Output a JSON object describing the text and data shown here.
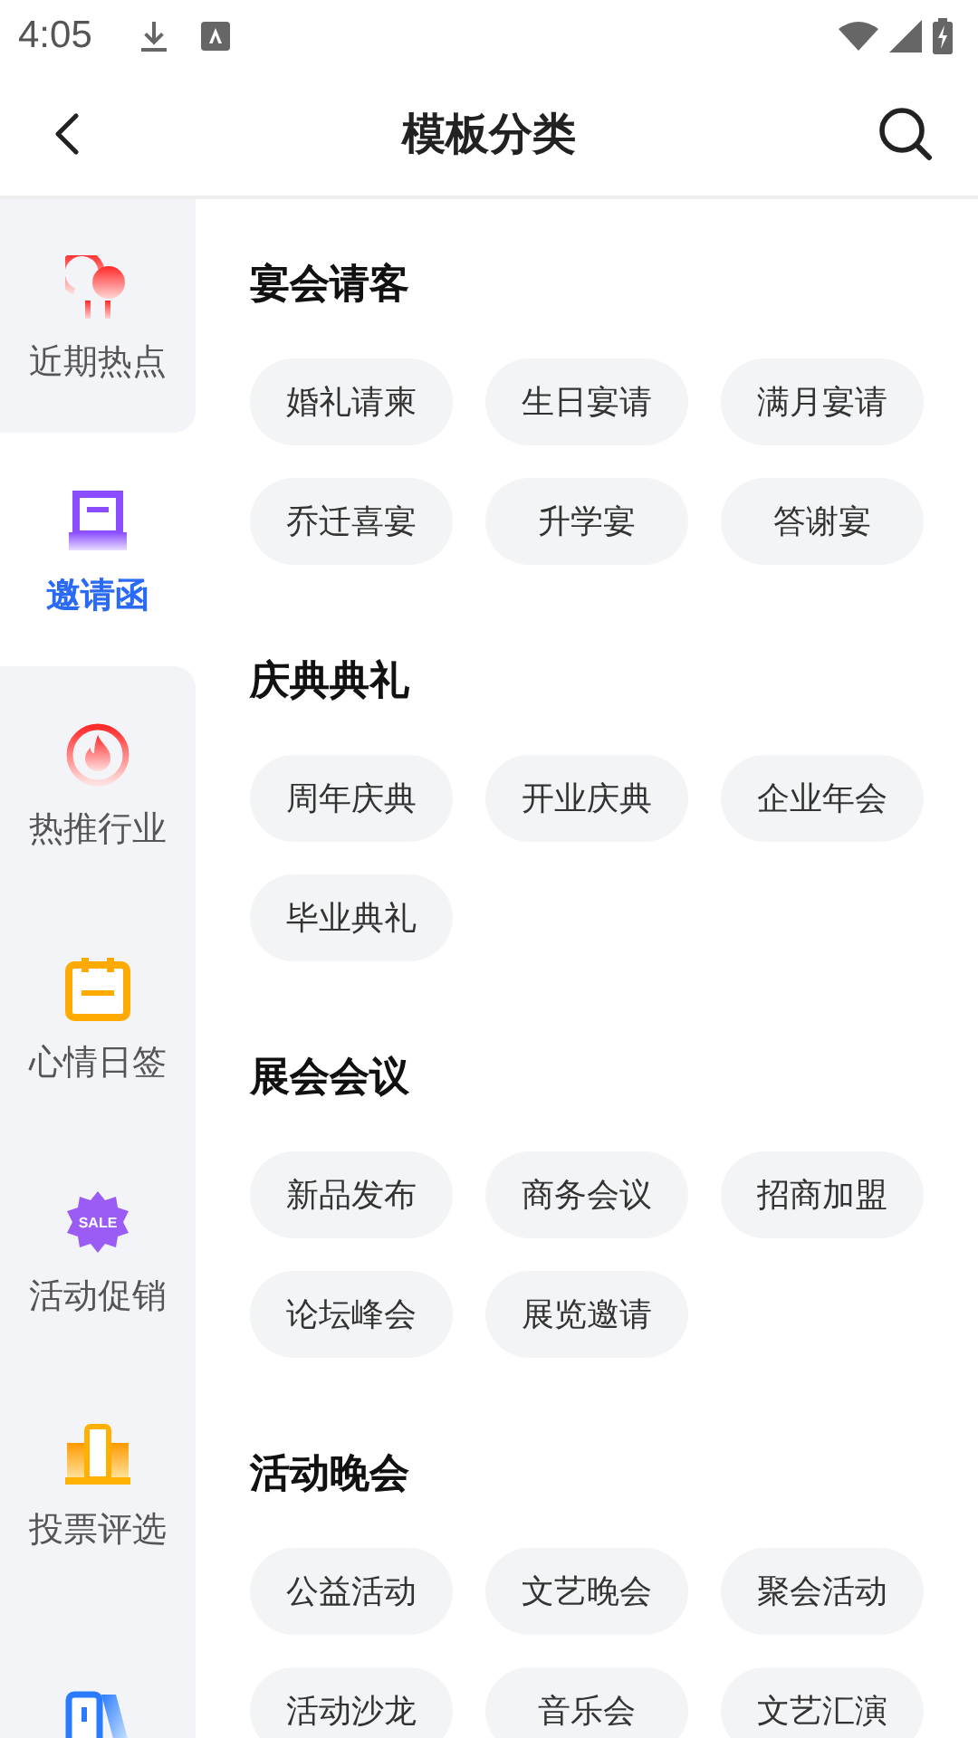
{
  "status_bar": {
    "time": "4:05"
  },
  "header": {
    "title": "模板分类"
  },
  "sidebar": {
    "items": [
      {
        "label": "近期热点",
        "kind": "balloons",
        "selected": false
      },
      {
        "label": "邀请函",
        "kind": "card",
        "selected": true
      },
      {
        "label": "热推行业",
        "kind": "flame",
        "selected": false
      },
      {
        "label": "心情日签",
        "kind": "calendar",
        "selected": false
      },
      {
        "label": "活动促销",
        "kind": "sale",
        "badge": "SALE",
        "selected": false
      },
      {
        "label": "投票评选",
        "kind": "podium",
        "selected": false
      },
      {
        "kind": "phone",
        "selected": false
      }
    ]
  },
  "sections": [
    {
      "title": "宴会请客",
      "tags": [
        "婚礼请柬",
        "生日宴请",
        "满月宴请",
        "乔迁喜宴",
        "升学宴",
        "答谢宴"
      ]
    },
    {
      "title": "庆典典礼",
      "tags": [
        "周年庆典",
        "开业庆典",
        "企业年会",
        "毕业典礼"
      ]
    },
    {
      "title": "展会会议",
      "tags": [
        "新品发布",
        "商务会议",
        "招商加盟",
        "论坛峰会",
        "展览邀请"
      ]
    },
    {
      "title": "活动晚会",
      "tags": [
        "公益活动",
        "文艺晚会",
        "聚会活动",
        "活动沙龙",
        "音乐会",
        "文艺汇演"
      ]
    }
  ]
}
